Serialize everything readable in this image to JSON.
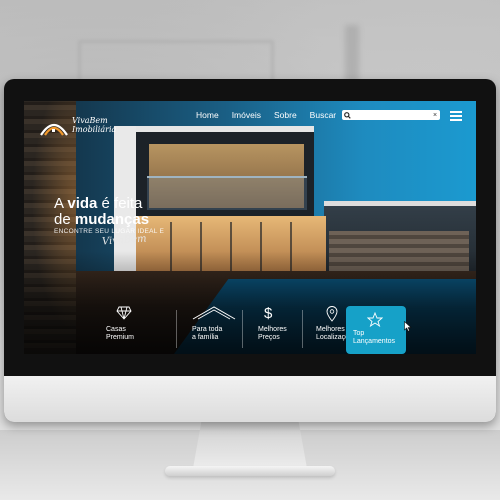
{
  "brand": {
    "name_line1": "VivaBem",
    "name_line2": "Imobiliária"
  },
  "nav": {
    "items": [
      "Home",
      "Imóveis",
      "Sobre",
      "Buscar"
    ]
  },
  "search": {
    "value": "",
    "placeholder": ""
  },
  "hero": {
    "title_pre": "A ",
    "title_bold1": "vida",
    "title_mid": " é feita",
    "title_line2_pre": "de ",
    "title_bold2": "mudanças",
    "subtitle": "ENCONTRE SEU LUGAR IDEAL E",
    "signature": "VivaBem"
  },
  "features": [
    {
      "icon": "diamond-icon",
      "line1": "Casas",
      "line2": "Premium"
    },
    {
      "icon": "roof-icon",
      "line1": "Para toda",
      "line2": "a família"
    },
    {
      "icon": "dollar-icon",
      "line1": "Melhores",
      "line2": "Preços"
    },
    {
      "icon": "location-pin-icon",
      "line1": "Melhores",
      "line2": "Localizações"
    },
    {
      "icon": "star-icon",
      "line1": "Top",
      "line2": "Lançamentos"
    }
  ],
  "colors": {
    "accent": "#16a1c8",
    "sky": "#1b9ad0",
    "brand_orange": "#f39a2d"
  }
}
